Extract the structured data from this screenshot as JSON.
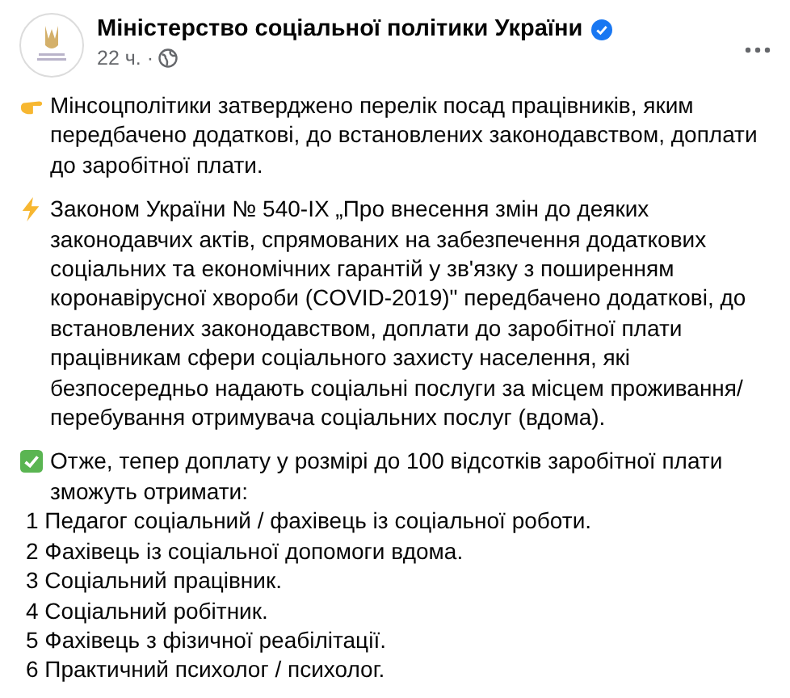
{
  "post": {
    "author": "Міністерство соціальної політики України",
    "verified": true,
    "time": "22 ч. ·",
    "paragraphs": [
      {
        "kind": "pointer",
        "text": "Мінсоцполітики затверджено перелік посад працівників, яким\nпередбачено додаткові, до встановлених законодавством, доплати\nдо заробітної плати."
      },
      {
        "kind": "lightning",
        "text": "Законом України № 540-IX „Про внесення змін до деяких\nзаконодавчих актів, спрямованих на забезпечення додаткових\nсоціальних та економічних гарантій у зв'язку з поширенням\nкоронавірусної хвороби (COVID-2019)\" передбачено додаткові, до\nвстановлених законодавством, доплати до заробітної плати\nпрацівникам сфери соціального захисту населення, які\nбезпосередньо надають соціальні послуги за місцем проживання/\nперебування отримувача соціальних послуг (вдома)."
      },
      {
        "kind": "check",
        "text": "Отже, тепер доплату у розмірі до 100 відсотків заробітної плати\nзможуть отримати:"
      }
    ],
    "list": [
      "1 Педагог соціальний / фахівець із соціальної роботи.",
      "2 Фахівець із соціальної допомоги вдома.",
      "3 Соціальний працівник.",
      "4 Соціальний робітник.",
      "5 Фахівець з фізичної реабілітації.",
      "6 Практичний психолог / психолог."
    ]
  }
}
